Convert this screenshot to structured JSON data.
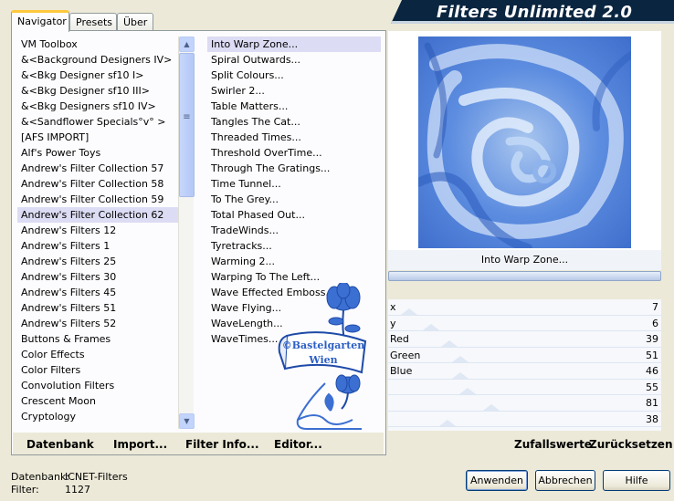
{
  "header": {
    "title": "Filters Unlimited 2.0"
  },
  "tabs": [
    {
      "label": "Navigator",
      "active": true
    },
    {
      "label": "Presets",
      "active": false
    },
    {
      "label": "Über",
      "active": false
    }
  ],
  "categories": [
    "VM Toolbox",
    "&<Background Designers IV>",
    "&<Bkg Designer sf10 I>",
    "&<Bkg Designer sf10 III>",
    "&<Bkg Designers sf10 IV>",
    "&<Sandflower Specials°v° >",
    "[AFS IMPORT]",
    "Alf's Power Toys",
    "Andrew's Filter Collection 57",
    "Andrew's Filter Collection 58",
    "Andrew's Filter Collection 59",
    "Andrew's Filter Collection 62",
    "Andrew's Filters 12",
    "Andrew's Filters 1",
    "Andrew's Filters 25",
    "Andrew's Filters 30",
    "Andrew's Filters 45",
    "Andrew's Filters 51",
    "Andrew's Filters 52",
    "Buttons & Frames",
    "Color Effects",
    "Color Filters",
    "Convolution Filters",
    "Crescent Moon",
    "Cryptology"
  ],
  "selected_category": "Andrew's Filter Collection 62",
  "filters": [
    "Into Warp Zone...",
    "Spiral Outwards...",
    "Split Colours...",
    "Swirler 2...",
    "Table Matters...",
    "Tangles The Cat...",
    "Threaded Times...",
    "Threshold OverTime...",
    "Through The Gratings...",
    "Time Tunnel...",
    "To The Grey...",
    "Total Phased Out...",
    "TradeWinds...",
    "Tyretracks...",
    "Warming 2...",
    "Warping To The Left...",
    "Wave Effected Emboss...",
    "Wave Flying...",
    "WaveLength...",
    "WaveTimes..."
  ],
  "selected_filter": "Into Warp Zone...",
  "watermark": {
    "line1": "©Bastelgarten",
    "line2": "Wien"
  },
  "preview": {
    "filter_name": "Into Warp Zone..."
  },
  "params": [
    {
      "label": "x",
      "value": "7"
    },
    {
      "label": "y",
      "value": "6"
    },
    {
      "label": "Red",
      "value": "39"
    },
    {
      "label": "Green",
      "value": "51"
    },
    {
      "label": "Blue",
      "value": "46"
    },
    {
      "label": "",
      "value": "55"
    },
    {
      "label": "",
      "value": "81"
    },
    {
      "label": "",
      "value": "38"
    }
  ],
  "bottom_links": {
    "database": "Datenbank",
    "import": "Import...",
    "filter_info": "Filter Info...",
    "editor": "Editor...",
    "random": "Zufallswerte",
    "reset": "Zurücksetzen"
  },
  "status": {
    "db_label": "Datenbank:",
    "db_value": "ICNET-Filters",
    "filter_label": "Filter:",
    "filter_value": "1127"
  },
  "buttons": {
    "apply": "Anwenden",
    "cancel": "Abbrechen",
    "help": "Hilfe"
  },
  "colors": {
    "selection": "#dcdcf4",
    "banner": "#0a2540",
    "preview_blue": "#3b6fd0"
  }
}
